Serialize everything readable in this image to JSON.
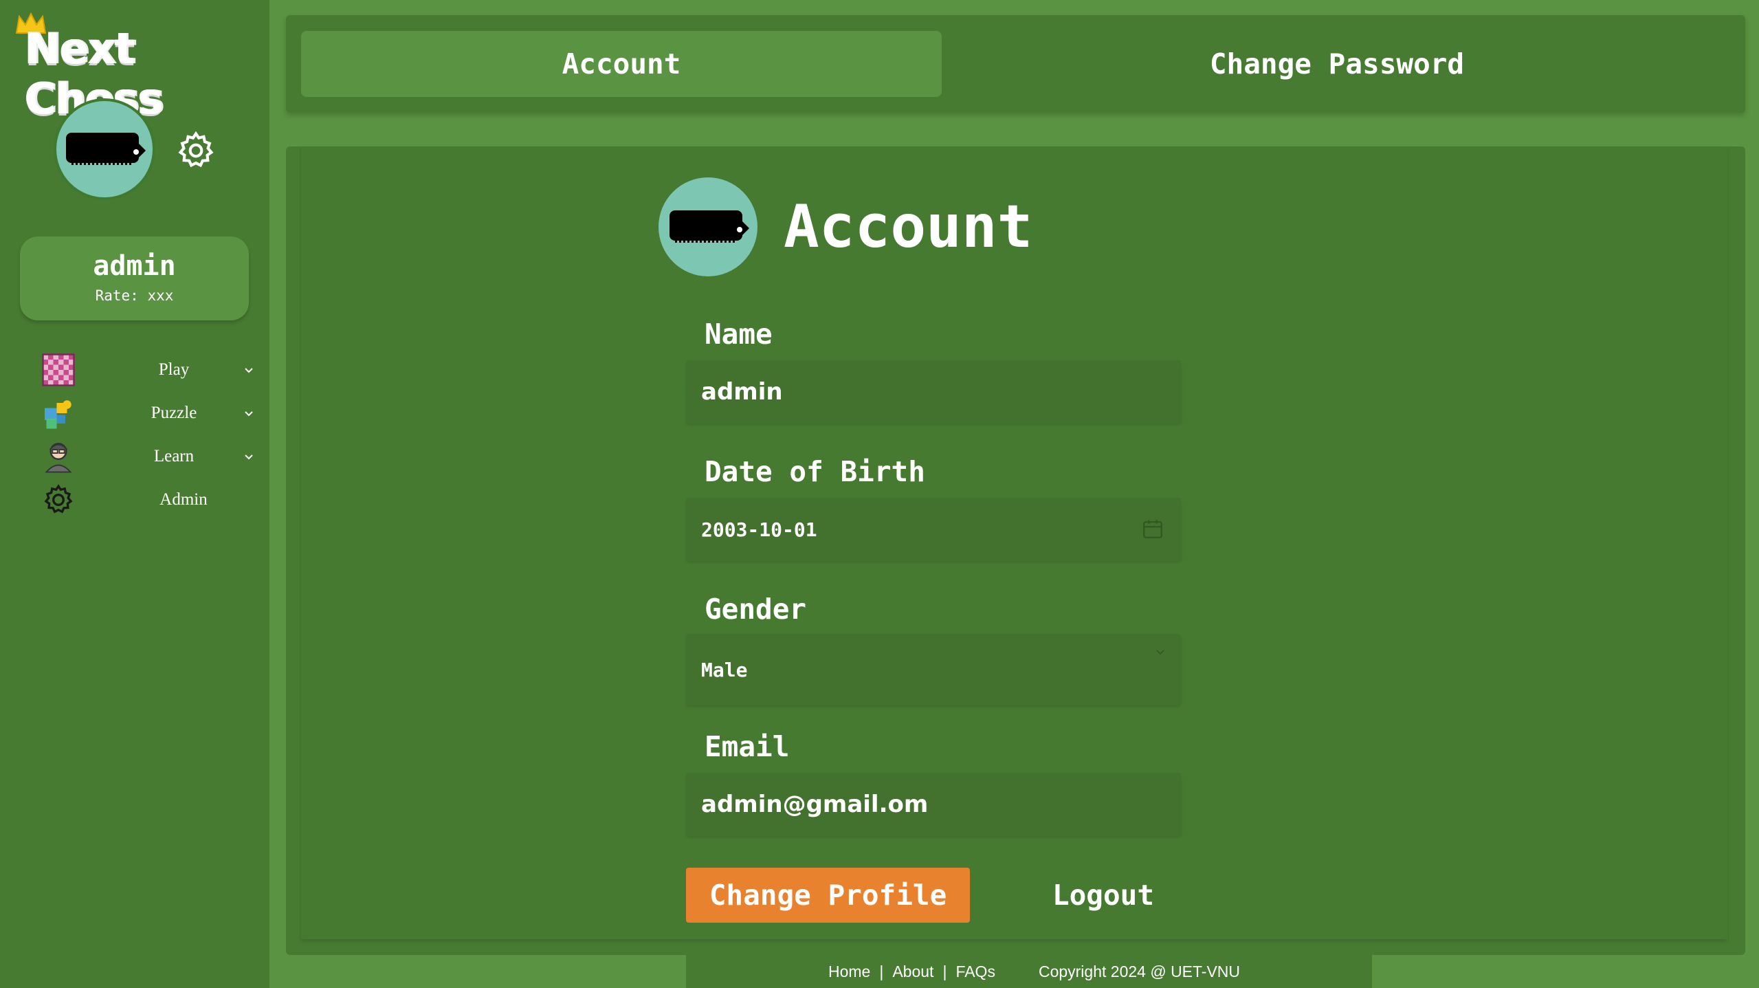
{
  "brand": {
    "logo_text": "Next Chess"
  },
  "sidebar": {
    "username": "admin",
    "rate": "Rate: xxx",
    "items": [
      {
        "label": "Play"
      },
      {
        "label": "Puzzle"
      },
      {
        "label": "Learn"
      },
      {
        "label": "Admin"
      }
    ]
  },
  "tabs": [
    {
      "label": "Account",
      "active": true
    },
    {
      "label": "Change Password",
      "active": false
    }
  ],
  "account": {
    "title": "Account",
    "name_label": "Name",
    "name_value": "admin",
    "dob_label": "Date of Birth",
    "dob_value": "2003-10-01",
    "gender_label": "Gender",
    "gender_value": "Male",
    "email_label": "Email",
    "email_value": "admin@gmail.om",
    "change_profile_label": "Change Profile",
    "logout_label": "Logout"
  },
  "footer": {
    "links": [
      "Home",
      "About",
      "FAQs"
    ],
    "separator": "|",
    "copyright": "Copyright 2024 @ UET-VNU"
  },
  "colors": {
    "background": "#5a9341",
    "panel": "#487b32",
    "field": "#42722e",
    "accent": "#e9822e",
    "avatar": "#7cc6b2"
  }
}
